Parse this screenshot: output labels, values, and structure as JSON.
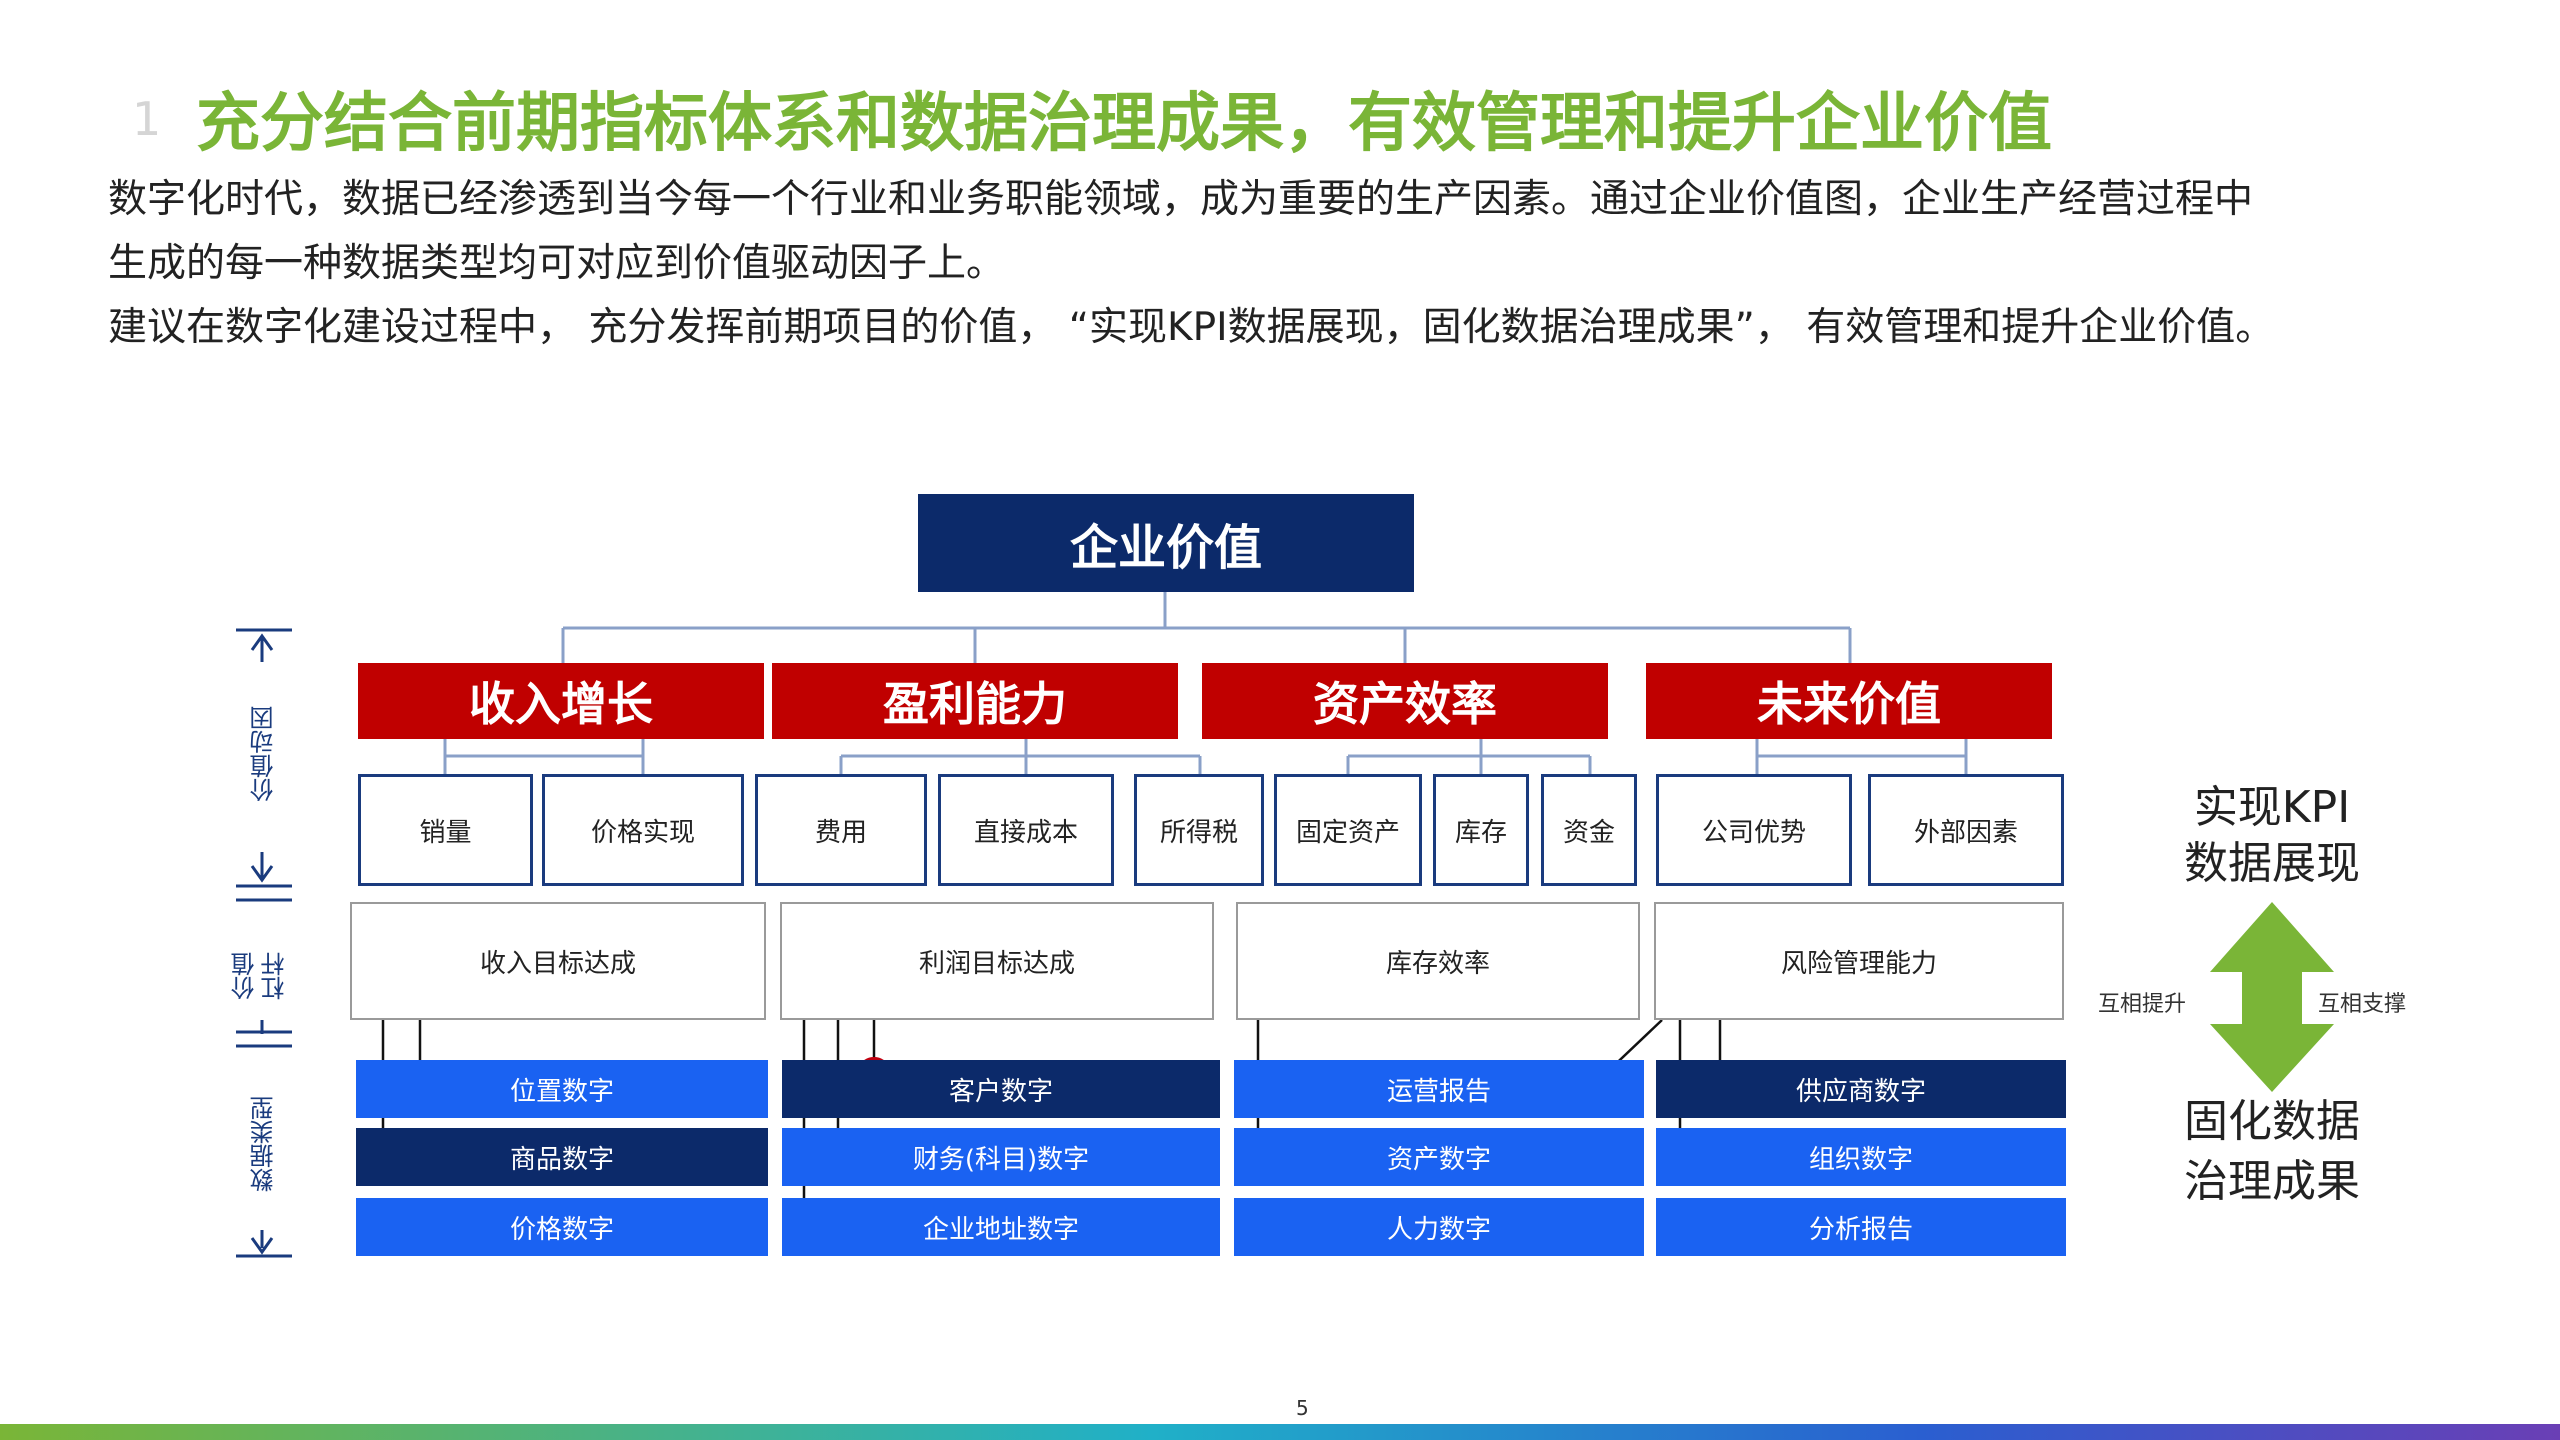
{
  "slide": {
    "number_mark": "1",
    "page_number": "5"
  },
  "title": "充分结合前期指标体系和数据治理成果，有效管理和提升企业价值",
  "paragraph1": {
    "line1": "数字化时代，数据已经渗透到当今每一个行业和业务职能领域，成为重要的生产因素。通过企业价值图，企业生产经营过程中",
    "line2": "生成的每一种数据类型均可对应到价值驱动因子上。"
  },
  "paragraph2": "建议在数字化建设过程中， 充分发挥前期项目的价值，  “实现KPI数据展现，固化数据治理成果”， 有效管理和提升企业价值。",
  "diagram": {
    "root": "企业价值",
    "categories": [
      "收入增长",
      "盈利能力",
      "资产效率",
      "未来价值"
    ],
    "drivers": [
      "销量",
      "价格实现",
      "费用",
      "直接成本",
      "所得税",
      "固定资产",
      "库存",
      "资金",
      "公司优势",
      "外部因素"
    ],
    "levers": [
      "收入目标达成",
      "利润目标达成",
      "库存效率",
      "风险管理能力"
    ],
    "data_types": {
      "row1": [
        "位置数字",
        "客户数字",
        "运营报告",
        "供应商数字"
      ],
      "row2": [
        "商品数字",
        "财务(科目)数字",
        "资产数字",
        "组织数字"
      ],
      "row3": [
        "价格数字",
        "企业地址数字",
        "人力数字",
        "分析报告"
      ]
    },
    "side_labels": {
      "value_drivers": "价值动因",
      "value_levers": "价值杠杆",
      "data_types": "数据类型"
    }
  },
  "right_panel": {
    "kpi_line1": "实现KPI",
    "kpi_line2": "数据展现",
    "solid_line1": "固化数据",
    "solid_line2": "治理成果",
    "left_note": "互相提升",
    "right_note": "互相支撑"
  },
  "colors": {
    "title_green": "#7ab537",
    "navy": "#0c2a6a",
    "red": "#c00000",
    "bright_blue": "#1a62f2",
    "arrow_green": "#7ab537",
    "dot_red": "#c00010"
  }
}
